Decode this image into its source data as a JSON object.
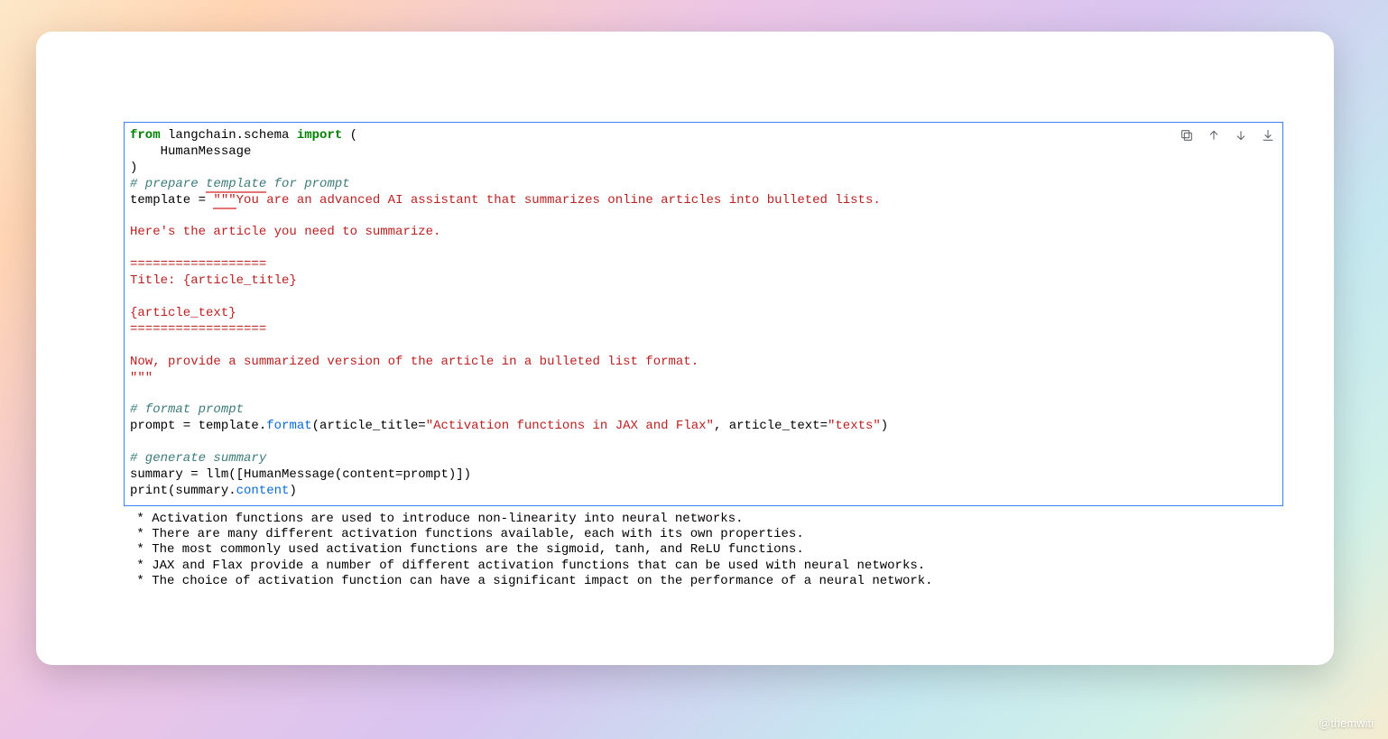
{
  "code": {
    "l1a": "from",
    "l1b": " langchain.schema ",
    "l1c": "import",
    "l1d": " (",
    "l2": "    HumanMessage",
    "l3": ")",
    "l4": "# prepare ",
    "l4u": "template",
    "l4b": " for prompt",
    "l5a": "template = ",
    "l5u": "\"\"\"",
    "l5b": "You are an advanced AI assistant that summarizes online articles into bulleted lists.",
    "l6": "",
    "l7": "Here's the article you need to summarize.",
    "l8": "",
    "l9": "==================",
    "l10": "Title: {article_title}",
    "l11": "",
    "l12": "{article_text}",
    "l13": "==================",
    "l14": "",
    "l15": "Now, provide a summarized version of the article in a bulleted list format.",
    "l16": "\"\"\"",
    "l17": "",
    "l18": "# format prompt",
    "l19a": "prompt = template.",
    "l19b": "format",
    "l19c": "(article_title=",
    "l19d": "\"Activation functions in JAX and Flax\"",
    "l19e": ", article_text=",
    "l19f": "\"texts\"",
    "l19g": ")",
    "l20": "",
    "l21": "# generate summary",
    "l22": "summary = llm([HumanMessage(content=prompt)])",
    "l23a": "print(summary.",
    "l23b": "content",
    "l23c": ")"
  },
  "output": {
    "o1": " * Activation functions are used to introduce non-linearity into neural networks.",
    "o2": " * There are many different activation functions available, each with its own properties.",
    "o3": " * The most commonly used activation functions are the sigmoid, tanh, and ReLU functions.",
    "o4": " * JAX and Flax provide a number of different activation functions that can be used with neural networks.",
    "o5": " * The choice of activation function can have a significant impact on the performance of a neural network."
  },
  "credit": "@themwiti",
  "icons": {
    "copy": "copy-icon",
    "up": "arrow-up-icon",
    "down": "arrow-down-icon",
    "link": "link-icon"
  }
}
